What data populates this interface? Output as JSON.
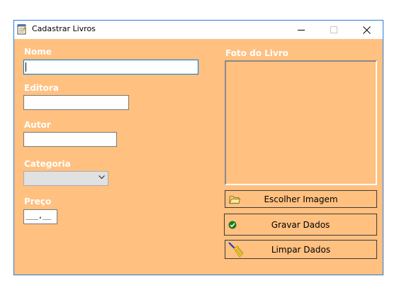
{
  "window": {
    "title": "Cadastrar Livros",
    "icons": {
      "app": "notepad-icon",
      "minimize": "minimize-icon",
      "maximize": "maximize-icon",
      "close": "close-icon"
    }
  },
  "form": {
    "nome_label": "Nome",
    "nome_value": "",
    "editora_label": "Editora",
    "editora_value": "",
    "autor_label": "Autor",
    "autor_value": "",
    "categoria_label": "Categoria",
    "categoria_value": "",
    "preco_label": "Preço",
    "preco_value": "___,__",
    "foto_label": "Foto do Livro"
  },
  "buttons": {
    "escolher": {
      "label": "Escolher Imagem",
      "icon": "folder-icon"
    },
    "gravar": {
      "label": "Gravar Dados",
      "icon": "check-circle-icon"
    },
    "limpar": {
      "label": "Limpar Dados",
      "icon": "broom-icon"
    }
  },
  "colors": {
    "form_bg": "#ffc080",
    "label_text": "#ffffff",
    "window_border": "#2b7bd6"
  }
}
